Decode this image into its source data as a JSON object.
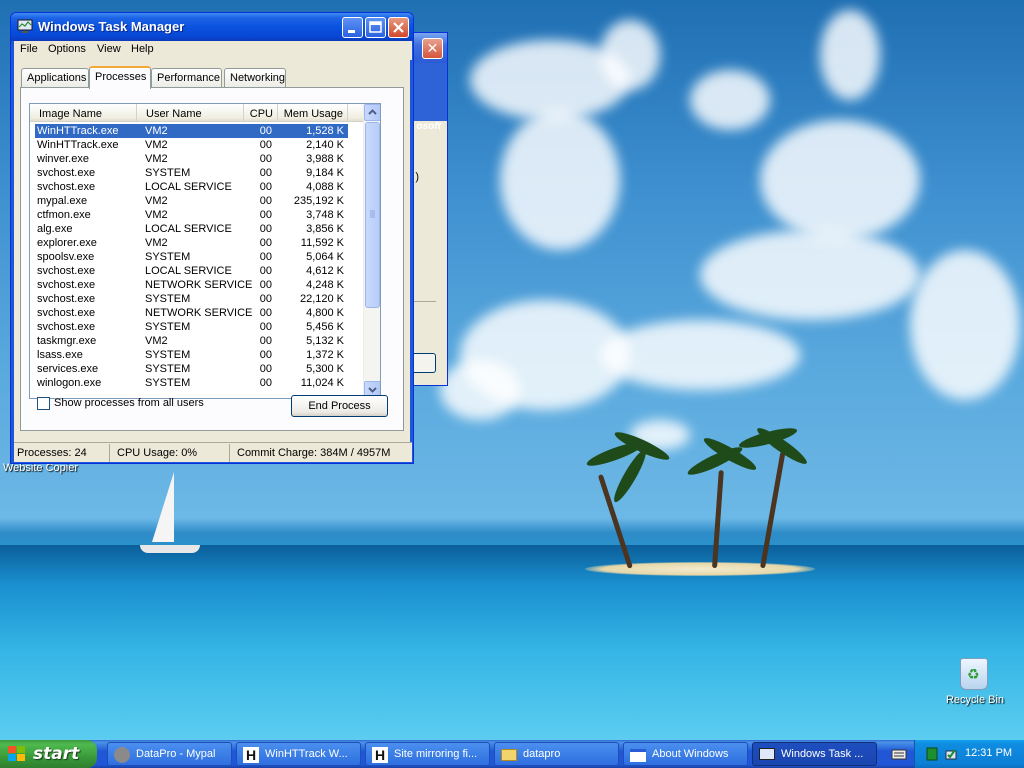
{
  "desktop": {
    "labels": [
      "Website Copier"
    ],
    "recycle_bin": "Recycle Bin"
  },
  "background_window": {
    "banner_text": "osoft",
    "paren_text": ")"
  },
  "taskmgr": {
    "title": "Windows Task Manager",
    "menu": [
      "File",
      "Options",
      "View",
      "Help"
    ],
    "tabs": [
      "Applications",
      "Processes",
      "Performance",
      "Networking"
    ],
    "active_tab": "Processes",
    "columns": [
      "Image Name",
      "User Name",
      "CPU",
      "Mem Usage"
    ],
    "processes": [
      {
        "image": "WinHTTrack.exe",
        "user": "VM2",
        "cpu": "00",
        "mem": "1,528 K"
      },
      {
        "image": "WinHTTrack.exe",
        "user": "VM2",
        "cpu": "00",
        "mem": "2,140 K"
      },
      {
        "image": "winver.exe",
        "user": "VM2",
        "cpu": "00",
        "mem": "3,988 K"
      },
      {
        "image": "svchost.exe",
        "user": "SYSTEM",
        "cpu": "00",
        "mem": "9,184 K"
      },
      {
        "image": "svchost.exe",
        "user": "LOCAL SERVICE",
        "cpu": "00",
        "mem": "4,088 K"
      },
      {
        "image": "mypal.exe",
        "user": "VM2",
        "cpu": "00",
        "mem": "235,192 K"
      },
      {
        "image": "ctfmon.exe",
        "user": "VM2",
        "cpu": "00",
        "mem": "3,748 K"
      },
      {
        "image": "alg.exe",
        "user": "LOCAL SERVICE",
        "cpu": "00",
        "mem": "3,856 K"
      },
      {
        "image": "explorer.exe",
        "user": "VM2",
        "cpu": "00",
        "mem": "11,592 K"
      },
      {
        "image": "spoolsv.exe",
        "user": "SYSTEM",
        "cpu": "00",
        "mem": "5,064 K"
      },
      {
        "image": "svchost.exe",
        "user": "LOCAL SERVICE",
        "cpu": "00",
        "mem": "4,612 K"
      },
      {
        "image": "svchost.exe",
        "user": "NETWORK SERVICE",
        "cpu": "00",
        "mem": "4,248 K"
      },
      {
        "image": "svchost.exe",
        "user": "SYSTEM",
        "cpu": "00",
        "mem": "22,120 K"
      },
      {
        "image": "svchost.exe",
        "user": "NETWORK SERVICE",
        "cpu": "00",
        "mem": "4,800 K"
      },
      {
        "image": "svchost.exe",
        "user": "SYSTEM",
        "cpu": "00",
        "mem": "5,456 K"
      },
      {
        "image": "taskmgr.exe",
        "user": "VM2",
        "cpu": "00",
        "mem": "5,132 K"
      },
      {
        "image": "lsass.exe",
        "user": "SYSTEM",
        "cpu": "00",
        "mem": "1,372 K"
      },
      {
        "image": "services.exe",
        "user": "SYSTEM",
        "cpu": "00",
        "mem": "5,300 K"
      },
      {
        "image": "winlogon.exe",
        "user": "SYSTEM",
        "cpu": "00",
        "mem": "11,024 K"
      }
    ],
    "selected_index": 0,
    "show_all_label": "Show processes from all users",
    "show_all_checked": false,
    "end_process_label": "End Process",
    "status": {
      "processes": "Processes: 24",
      "cpu_usage": "CPU Usage: 0%",
      "commit_charge": "Commit Charge: 384M / 4957M"
    }
  },
  "taskbar": {
    "start_label": "start",
    "tasks": [
      {
        "icon": "raccoon-icon",
        "label": "DataPro - Mypal"
      },
      {
        "icon": "httrack-icon",
        "label": "WinHTTrack W..."
      },
      {
        "icon": "httrack-icon",
        "label": "Site mirroring fi..."
      },
      {
        "icon": "folder-icon",
        "label": "datapro"
      },
      {
        "icon": "window-icon",
        "label": "About Windows"
      },
      {
        "icon": "taskmgr-icon",
        "label": "Windows Task ..."
      }
    ],
    "active_task_index": 5,
    "clock": "12:31 PM"
  },
  "colors": {
    "xp_blue": "#0a52e0",
    "selection": "#316ac5",
    "start_green": "#3a9a3a",
    "tray_blue": "#0f8ce0"
  }
}
